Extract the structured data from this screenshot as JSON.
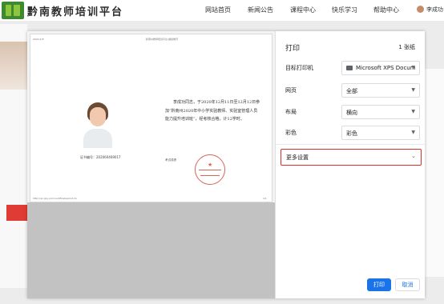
{
  "site": {
    "title": "黔南教师培训平台",
    "nav": [
      "网站首页",
      "新闻公告",
      "课程中心",
      "快乐学习",
      "帮助中心"
    ],
    "user_name": "李成功"
  },
  "certificate": {
    "header_left": "2021/1/8",
    "header_center": "黔南州教师培训平台-继续教育",
    "body_text": "李成功同志，于2020年12月11日至12月12日参加“黔南州2020年中小学实验教师、实验室管理人员能力提升培训班”，经考核合格，计12学时。",
    "id_label": "证书编号：",
    "id_value": "202060469017",
    "sign_label": "考试成绩",
    "footer_left": "http://qn.jxjy.com/certificate/print.do",
    "footer_right": "1/1"
  },
  "print_dialog": {
    "title": "打印",
    "sheet_count": "1 张纸",
    "destination_label": "目标打印机",
    "destination_value": "Microsoft XPS Docum",
    "pages_label": "网页",
    "pages_value": "全部",
    "layout_label": "布局",
    "layout_value": "横向",
    "color_label": "彩色",
    "color_value": "彩色",
    "more_settings": "更多设置",
    "print_button": "打印",
    "cancel_button": "取消"
  },
  "colors": {
    "primary": "#1a73e8",
    "highlight_border": "#d93025",
    "brand_green": "#3f8a2e"
  }
}
